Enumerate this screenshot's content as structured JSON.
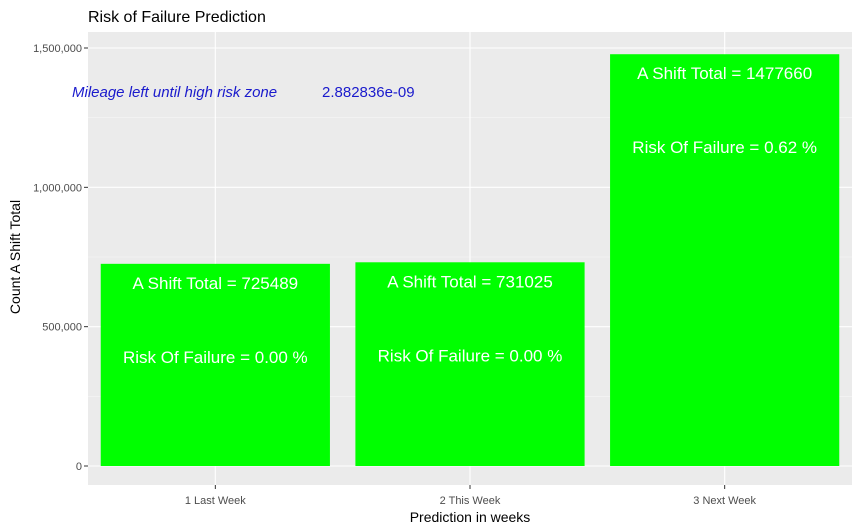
{
  "chart_data": {
    "type": "bar",
    "title": "Risk of Failure Prediction",
    "xlabel": "Prediction in weeks",
    "ylabel": "Count A Shift Total",
    "categories": [
      "1 Last Week",
      "2 This Week",
      "3 Next Week"
    ],
    "values": [
      725489,
      731025,
      1477660
    ],
    "ylim": [
      0,
      1500000
    ],
    "y_ticks": [
      0,
      500000,
      1000000,
      1500000
    ],
    "y_tick_labels": [
      "0",
      "500,000",
      "1,000,000",
      "1,500,000"
    ],
    "grid": true,
    "bar_color": "#00ff00",
    "panel_background": "#ebebeb",
    "label_color": "#ffffff",
    "bar_labels": [
      {
        "total": "A Shift Total = 725489",
        "risk": "Risk Of Failure = 0.00 %"
      },
      {
        "total": "A Shift Total = 731025",
        "risk": "Risk Of Failure = 0.00 %"
      },
      {
        "total": "A Shift Total = 1477660",
        "risk": "Risk Of Failure = 0.62 %"
      }
    ],
    "annotation": {
      "label": "Mileage left until high risk zone",
      "value": "2.882836e-09",
      "color": "#1a1acc"
    }
  }
}
